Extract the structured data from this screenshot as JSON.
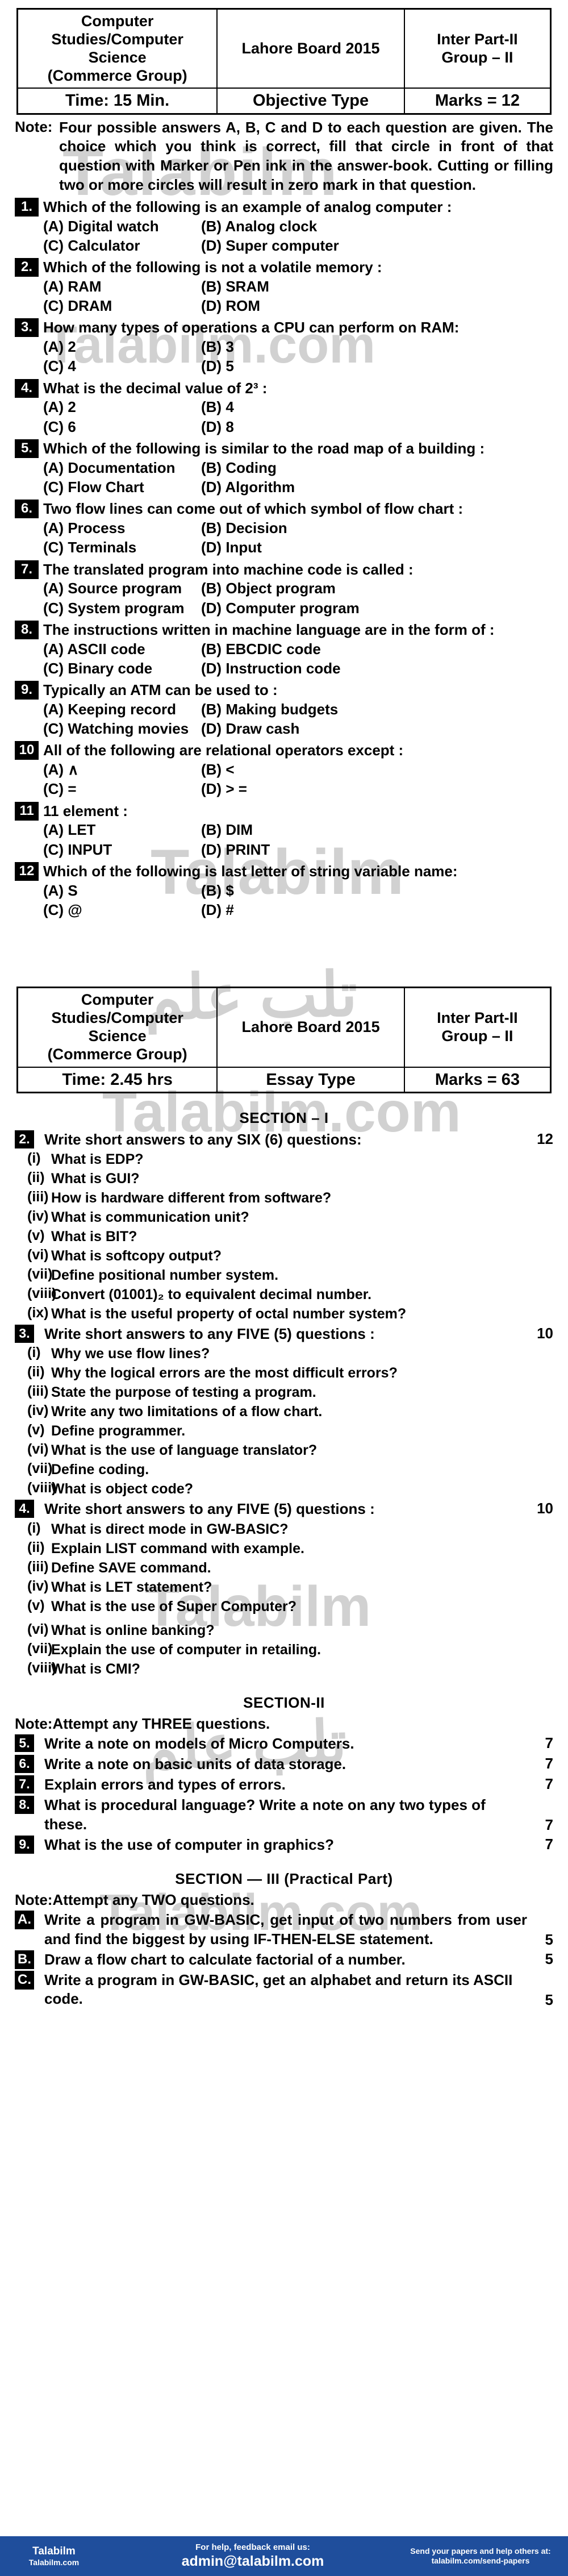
{
  "paper1": {
    "subject": "Computer Studies/Computer Science (Commerce Group)",
    "subject_line1": "Computer",
    "subject_line2": "Studies/Computer",
    "subject_line3": "Science",
    "subject_line4": "(Commerce Group)",
    "board": "Lahore Board 2015",
    "group_line1": "Inter Part-II",
    "group_line2": "Group – II",
    "time": "Time: 15 Min.",
    "type": "Objective Type",
    "marks": "Marks = 12"
  },
  "paper1_note": {
    "label": "Note:",
    "text": "Four possible answers A, B, C and D to each question are given. The choice which you think is correct, fill that circle in front of that question with Marker or Pen ink in the answer-book. Cutting or filling two or more circles will result in zero mark in that question."
  },
  "mcqs": [
    {
      "num": "1.",
      "text": "Which of the following is an example of analog computer :",
      "a": "(A) Digital watch",
      "b": "(B) Analog clock",
      "c": "(C) Calculator",
      "d": "(D) Super computer"
    },
    {
      "num": "2.",
      "text": "Which of the following is not a volatile memory :",
      "a": "(A) RAM",
      "b": "(B) SRAM",
      "c": "(C) DRAM",
      "d": "(D) ROM"
    },
    {
      "num": "3.",
      "text": "How many types of operations a CPU can perform on RAM:",
      "a": "(A) 2",
      "b": "(B) 3",
      "c": "(C) 4",
      "d": "(D) 5"
    },
    {
      "num": "4.",
      "text": "What is the decimal value of 2³ :",
      "a": "(A) 2",
      "b": "(B) 4",
      "c": "(C) 6",
      "d": "(D) 8"
    },
    {
      "num": "5.",
      "text": "Which of the following is similar to the road map of a building :",
      "a": "(A) Documentation",
      "b": "(B) Coding",
      "c": "(C) Flow Chart",
      "d": "(D) Algorithm"
    },
    {
      "num": "6.",
      "text": "Two flow lines can come out of which symbol of flow chart :",
      "a": "(A) Process",
      "b": "(B) Decision",
      "c": "(C) Terminals",
      "d": "(D) Input"
    },
    {
      "num": "7.",
      "text": "The translated program into machine code is called :",
      "a": "(A) Source program",
      "b": "(B) Object program",
      "c": "(C) System program",
      "d": "(D) Computer program"
    },
    {
      "num": "8.",
      "text": "The instructions written in machine language are in the form of :",
      "a": "(A) ASCII code",
      "b": "(B) EBCDIC code",
      "c": "(C) Binary code",
      "d": "(D) Instruction code"
    },
    {
      "num": "9.",
      "text": "Typically an ATM can be used to :",
      "a": "(A) Keeping record",
      "b": "(B) Making budgets",
      "c": "(C) Watching movies",
      "d": "(D) Draw cash"
    },
    {
      "num": "10",
      "text": "All of the following are relational operators except :",
      "a": "(A) ∧",
      "b": "(B) <",
      "c": "(C) =",
      "d": "(D) > ="
    },
    {
      "num": "11",
      "text": "11 element :",
      "a": "(A) LET",
      "b": "(B) DIM",
      "c": "(C) INPUT",
      "d": "(D) PRINT"
    },
    {
      "num": "12",
      "text": "Which of the following is last letter of string variable name:",
      "a": "(A) S",
      "b": "(B) $",
      "c": "(C) @",
      "d": "(D) #"
    }
  ],
  "paper2": {
    "subject_line1": "Computer",
    "subject_line2": "Studies/Computer",
    "subject_line3": "Science",
    "subject_line4": "(Commerce Group)",
    "board": "Lahore Board 2015",
    "group_line1": "Inter Part-II",
    "group_line2": "Group – II",
    "time": "Time: 2.45 hrs",
    "type": "Essay Type",
    "marks": "Marks = 63"
  },
  "section1": {
    "heading": "SECTION – I",
    "questions": [
      {
        "num": "2.",
        "stem": "Write short answers to any SIX (6) questions:",
        "marks": "12",
        "parts": [
          {
            "rom": "(i)",
            "text": "What is EDP?"
          },
          {
            "rom": "(ii)",
            "text": "What is GUI?"
          },
          {
            "rom": "(iii)",
            "text": "How is hardware different from software?"
          },
          {
            "rom": "(iv)",
            "text": "What is communication unit?"
          },
          {
            "rom": "(v)",
            "text": "What is BIT?"
          },
          {
            "rom": "(vi)",
            "text": "What is softcopy output?"
          },
          {
            "rom": "(vii)",
            "text": "Define positional number system."
          },
          {
            "rom": "(viii)",
            "text": "Convert (01001)₂ to equivalent decimal number."
          },
          {
            "rom": "(ix)",
            "text": "What is the useful property of octal number system?"
          }
        ]
      },
      {
        "num": "3.",
        "stem": "Write short answers to any FIVE (5) questions :",
        "marks": "10",
        "parts": [
          {
            "rom": "(i)",
            "text": "Why we use flow lines?"
          },
          {
            "rom": "(ii)",
            "text": "Why the logical errors are the most difficult errors?"
          },
          {
            "rom": "(iii)",
            "text": "State the purpose of testing a program."
          },
          {
            "rom": "(iv)",
            "text": "Write any two limitations of a flow chart."
          },
          {
            "rom": "(v)",
            "text": "Define programmer."
          },
          {
            "rom": "(vi)",
            "text": "What is the use of language translator?"
          },
          {
            "rom": "(vii)",
            "text": "Define coding."
          },
          {
            "rom": "(viii)",
            "text": "What is object code?"
          }
        ]
      },
      {
        "num": "4.",
        "stem": "Write short answers to any FIVE (5) questions :",
        "marks": "10",
        "parts": [
          {
            "rom": "(i)",
            "text": "What is direct mode in GW-BASIC?"
          },
          {
            "rom": "(ii)",
            "text": "Explain LIST command with example."
          },
          {
            "rom": "(iii)",
            "text": "Define SAVE command."
          },
          {
            "rom": "(iv)",
            "text": "What is LET statement?"
          },
          {
            "rom": "(v)",
            "text": "What is the use of Super Computer?"
          },
          {
            "rom": "(vi)",
            "text": "What is online banking?"
          },
          {
            "rom": "(vii)",
            "text": "Explain the use of computer in retailing."
          },
          {
            "rom": "(viii)",
            "text": "What is CMI?"
          }
        ]
      }
    ]
  },
  "section2": {
    "heading": "SECTION-II",
    "note_label": "Note:",
    "note_text": "Attempt any THREE questions.",
    "questions": [
      {
        "num": "5.",
        "text": "Write a note on models of Micro Computers.",
        "marks": "7"
      },
      {
        "num": "6.",
        "text": "Write a note on basic units of data storage.",
        "marks": "7"
      },
      {
        "num": "7.",
        "text": "Explain errors and types of errors.",
        "marks": "7"
      },
      {
        "num": "8.",
        "text": "What is procedural language? Write a note on any two types of these.",
        "marks": "7"
      },
      {
        "num": "9.",
        "text": "What is the use of computer in graphics?",
        "marks": "7"
      }
    ]
  },
  "section3": {
    "heading": "SECTION — III (Practical Part)",
    "note_label": "Note:",
    "note_text": "Attempt any TWO questions.",
    "questions": [
      {
        "num": "A.",
        "text": "Write a program in GW-BASIC, get input of two numbers from user and find the biggest by using IF-THEN-ELSE statement.",
        "marks": "5"
      },
      {
        "num": "B.",
        "text": "Draw a flow chart to calculate factorial of a number.",
        "marks": "5"
      },
      {
        "num": "C.",
        "text": "Write a program in GW-BASIC, get an alphabet and return its ASCII code.",
        "marks": "5"
      }
    ]
  },
  "watermarks": [
    "Talabilm",
    "talabilm",
    "Talabilm",
    "تلب علم",
    "Talabilm.com",
    "Talabilm",
    "تلب علم",
    "Talabilm.com"
  ],
  "footer": {
    "brand": "Talabilm",
    "url": "Talabilm.com",
    "help_text": "For help, feedback email us:",
    "email": "admin@talabilm.com",
    "papers_text": "Send your papers and help others at:",
    "papers_link": "talabilm.com/send-papers",
    "bar_color": "#1f4e9c"
  }
}
